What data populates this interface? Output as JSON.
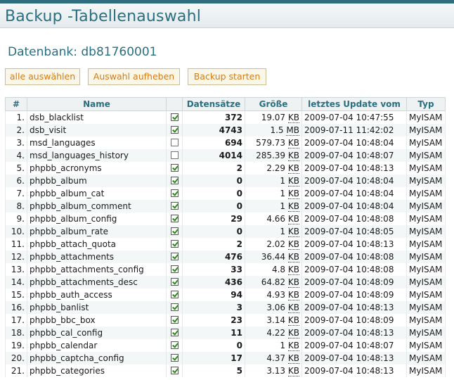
{
  "header": {
    "title": "Backup -Tabellenauswahl"
  },
  "database": {
    "label": "Datenbank: db81760001"
  },
  "buttons": {
    "select_all": "alle auswählen",
    "deselect": "Auswahl aufheben",
    "start": "Backup starten"
  },
  "table": {
    "columns": [
      "#",
      "Name",
      "",
      "Datensätze",
      "Größe",
      "letztes Update vom",
      "Typ"
    ],
    "rows": [
      {
        "num": "1.",
        "name": "dsb_blacklist",
        "checked": true,
        "records": "372",
        "size": "19.07",
        "unit": "KB",
        "updated": "2009-07-04 10:47:55",
        "type": "MyISAM"
      },
      {
        "num": "2.",
        "name": "dsb_visit",
        "checked": true,
        "records": "4743",
        "size": "1.5",
        "unit": "MB",
        "updated": "2009-07-11 11:42:02",
        "type": "MyISAM"
      },
      {
        "num": "3.",
        "name": "msd_languages",
        "checked": false,
        "records": "694",
        "size": "579.73",
        "unit": "KB",
        "updated": "2009-07-04 10:48:04",
        "type": "MyISAM"
      },
      {
        "num": "4.",
        "name": "msd_languages_history",
        "checked": false,
        "records": "4014",
        "size": "285.39",
        "unit": "KB",
        "updated": "2009-07-04 10:48:07",
        "type": "MyISAM"
      },
      {
        "num": "5.",
        "name": "phpbb_acronyms",
        "checked": true,
        "records": "2",
        "size": "2.29",
        "unit": "KB",
        "updated": "2009-07-04 10:48:13",
        "type": "MyISAM"
      },
      {
        "num": "6.",
        "name": "phpbb_album",
        "checked": true,
        "records": "0",
        "size": "1",
        "unit": "KB",
        "updated": "2009-07-04 10:48:04",
        "type": "MyISAM"
      },
      {
        "num": "7.",
        "name": "phpbb_album_cat",
        "checked": true,
        "records": "0",
        "size": "1",
        "unit": "KB",
        "updated": "2009-07-04 10:48:04",
        "type": "MyISAM"
      },
      {
        "num": "8.",
        "name": "phpbb_album_comment",
        "checked": true,
        "records": "0",
        "size": "1",
        "unit": "KB",
        "updated": "2009-07-04 10:48:04",
        "type": "MyISAM"
      },
      {
        "num": "9.",
        "name": "phpbb_album_config",
        "checked": true,
        "records": "29",
        "size": "4.66",
        "unit": "KB",
        "updated": "2009-07-04 10:48:08",
        "type": "MyISAM"
      },
      {
        "num": "10.",
        "name": "phpbb_album_rate",
        "checked": true,
        "records": "0",
        "size": "1",
        "unit": "KB",
        "updated": "2009-07-04 10:48:05",
        "type": "MyISAM"
      },
      {
        "num": "11.",
        "name": "phpbb_attach_quota",
        "checked": true,
        "records": "2",
        "size": "2.02",
        "unit": "KB",
        "updated": "2009-07-04 10:48:13",
        "type": "MyISAM"
      },
      {
        "num": "12.",
        "name": "phpbb_attachments",
        "checked": true,
        "records": "476",
        "size": "36.44",
        "unit": "KB",
        "updated": "2009-07-04 10:48:08",
        "type": "MyISAM"
      },
      {
        "num": "13.",
        "name": "phpbb_attachments_config",
        "checked": true,
        "records": "33",
        "size": "4.8",
        "unit": "KB",
        "updated": "2009-07-04 10:48:08",
        "type": "MyISAM"
      },
      {
        "num": "14.",
        "name": "phpbb_attachments_desc",
        "checked": true,
        "records": "436",
        "size": "64.82",
        "unit": "KB",
        "updated": "2009-07-04 10:48:09",
        "type": "MyISAM"
      },
      {
        "num": "15.",
        "name": "phpbb_auth_access",
        "checked": true,
        "records": "94",
        "size": "4.93",
        "unit": "KB",
        "updated": "2009-07-04 10:48:09",
        "type": "MyISAM"
      },
      {
        "num": "16.",
        "name": "phpbb_banlist",
        "checked": true,
        "records": "3",
        "size": "3.06",
        "unit": "KB",
        "updated": "2009-07-04 10:48:13",
        "type": "MyISAM"
      },
      {
        "num": "17.",
        "name": "phpbb_bbc_box",
        "checked": true,
        "records": "23",
        "size": "3.14",
        "unit": "KB",
        "updated": "2009-07-04 10:48:09",
        "type": "MyISAM"
      },
      {
        "num": "18.",
        "name": "phpbb_cal_config",
        "checked": true,
        "records": "11",
        "size": "4.22",
        "unit": "KB",
        "updated": "2009-07-04 10:48:13",
        "type": "MyISAM"
      },
      {
        "num": "19.",
        "name": "phpbb_calendar",
        "checked": true,
        "records": "0",
        "size": "1",
        "unit": "KB",
        "updated": "2009-07-04 10:48:07",
        "type": "MyISAM"
      },
      {
        "num": "20.",
        "name": "phpbb_captcha_config",
        "checked": true,
        "records": "17",
        "size": "4.37",
        "unit": "KB",
        "updated": "2009-07-04 10:48:13",
        "type": "MyISAM"
      },
      {
        "num": "21.",
        "name": "phpbb_categories",
        "checked": true,
        "records": "5",
        "size": "3.13",
        "unit": "KB",
        "updated": "2009-07-04 10:48:13",
        "type": "MyISAM"
      }
    ]
  },
  "colors": {
    "accent": "#2a6f80",
    "button_text": "#d27c1a",
    "check": "#2f8a1e"
  }
}
